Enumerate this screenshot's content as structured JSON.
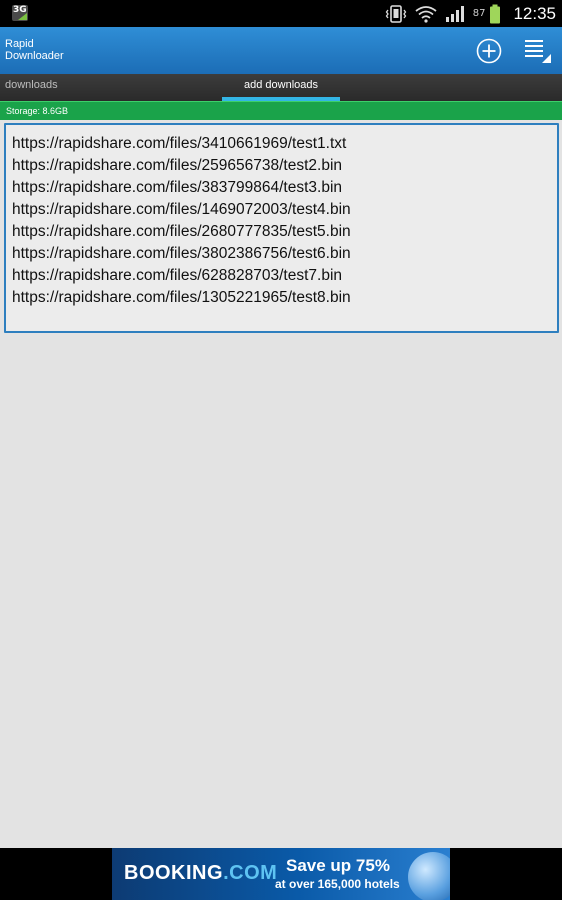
{
  "status_bar": {
    "network_badge": "3G",
    "battery_percent": "87",
    "time": "12:35"
  },
  "action_bar": {
    "title_line1": "Rapid",
    "title_line2": "Downloader"
  },
  "tabs": [
    {
      "label": "downloads",
      "selected": false
    },
    {
      "label": "add downloads",
      "selected": true
    }
  ],
  "storage": {
    "label": "Storage: 8.6GB"
  },
  "urls": [
    "https://rapidshare.com/files/3410661969/test1.txt",
    "https://rapidshare.com/files/259656738/test2.bin",
    "https://rapidshare.com/files/383799864/test3.bin",
    "https://rapidshare.com/files/1469072003/test4.bin",
    "https://rapidshare.com/files/2680777835/test5.bin",
    "https://rapidshare.com/files/3802386756/test6.bin",
    "https://rapidshare.com/files/628828703/test7.bin",
    "https://rapidshare.com/files/1305221965/test8.bin"
  ],
  "ad": {
    "brand_main": "BOOKING",
    "brand_suffix": ".COM",
    "headline": "Save up 75%",
    "subline": "at over 165,000 hotels"
  },
  "colors": {
    "action_bar": "#1c6db6",
    "tab_indicator": "#33b5e5",
    "storage_bar": "#1aa34a",
    "input_border": "#2e7fbf"
  },
  "icons": [
    "vibrate-icon",
    "wifi-icon",
    "signal-icon",
    "battery-icon",
    "add-circle-icon",
    "menu-list-icon",
    "globe-icon"
  ]
}
